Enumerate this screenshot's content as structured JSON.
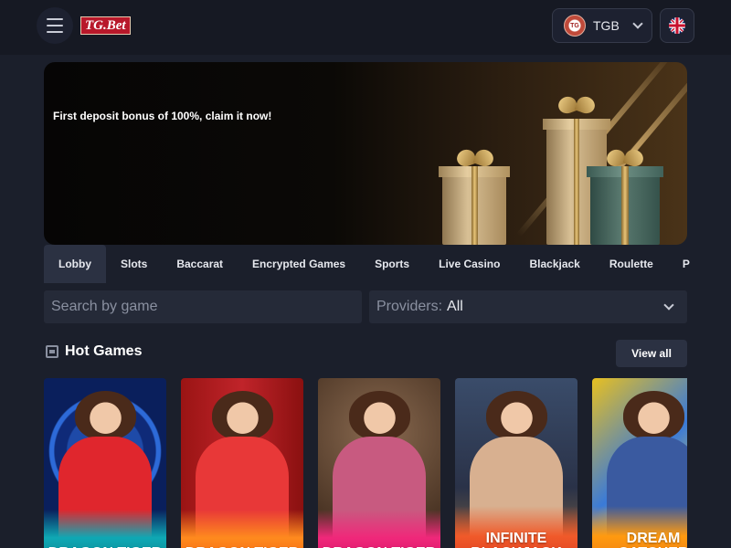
{
  "header": {
    "logo_text": "TG.Bet",
    "currency": "TGB",
    "coin_text": "TG"
  },
  "banner": {
    "text": "First deposit bonus of 100%, claim it now!"
  },
  "tabs": [
    {
      "label": "Lobby",
      "active": true
    },
    {
      "label": "Slots"
    },
    {
      "label": "Baccarat"
    },
    {
      "label": "Encrypted Games"
    },
    {
      "label": "Sports"
    },
    {
      "label": "Live Casino"
    },
    {
      "label": "Blackjack"
    },
    {
      "label": "Roulette"
    },
    {
      "label": "P"
    }
  ],
  "search": {
    "placeholder": "Search by game"
  },
  "providers": {
    "label": "Providers:",
    "value": "All"
  },
  "hot_games": {
    "title": "Hot Games",
    "view_all": "View all",
    "cards": [
      {
        "caption": "DRAGON TIGER"
      },
      {
        "caption": "DRAGON TIGER"
      },
      {
        "caption": "DRAGON TIGER"
      },
      {
        "caption": "INFINITE BLACKJACK"
      },
      {
        "caption": "DREAM CATCHER"
      }
    ]
  },
  "colors": {
    "background": "#1b1f2b",
    "header": "#161923",
    "tab_active": "#2b3142",
    "input_bg": "#252a38",
    "logo_red": "#b8182a"
  }
}
